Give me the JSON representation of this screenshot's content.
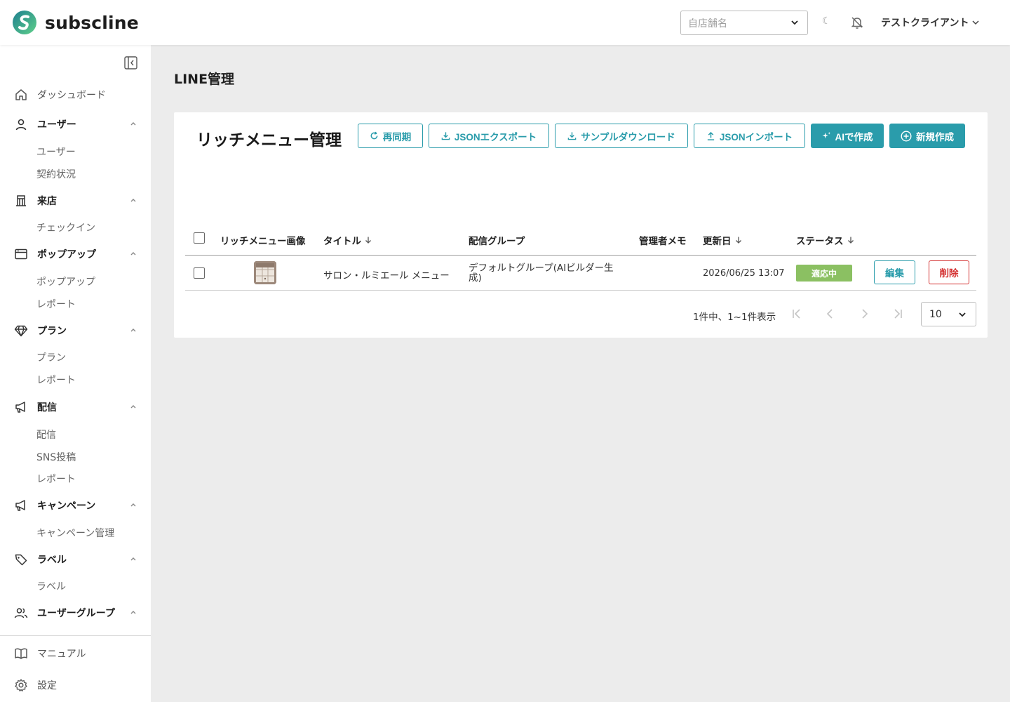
{
  "brand": {
    "name": "subscline"
  },
  "header": {
    "store_placeholder": "自店舗名",
    "theme_icon": "☾",
    "user_name": "テストクライアント"
  },
  "sidebar": {
    "dashboard": "ダッシュボード",
    "sections": [
      {
        "label": "ユーザー",
        "icon": "user-icon",
        "items": [
          "ユーザー",
          "契約状況"
        ]
      },
      {
        "label": "来店",
        "icon": "building-icon",
        "items": [
          "チェックイン"
        ]
      },
      {
        "label": "ポップアップ",
        "icon": "window-icon",
        "items": [
          "ポップアップ",
          "レポート"
        ]
      },
      {
        "label": "プラン",
        "icon": "diamond-icon",
        "items": [
          "プラン",
          "レポート"
        ]
      },
      {
        "label": "配信",
        "icon": "megaphone-icon",
        "items": [
          "配信",
          "SNS投稿",
          "レポート"
        ]
      },
      {
        "label": "キャンペーン",
        "icon": "megaphone-icon",
        "items": [
          "キャンペーン管理"
        ]
      },
      {
        "label": "ラベル",
        "icon": "tag-icon",
        "items": [
          "ラベル"
        ]
      },
      {
        "label": "ユーザーグループ",
        "icon": "users-icon",
        "items": []
      }
    ],
    "manual": "マニュアル",
    "settings": "設定"
  },
  "main": {
    "page_title": "LINE管理",
    "card_title": "リッチメニュー管理",
    "buttons": {
      "resync": "再同期",
      "json_export": "JSONエクスポート",
      "sample_download": "サンプルダウンロード",
      "json_import": "JSONインポート",
      "ai_create": "AIで作成",
      "new_create": "新規作成"
    },
    "table": {
      "columns": [
        "リッチメニュー画像",
        "タイトル",
        "配信グループ",
        "管理者メモ",
        "更新日",
        "ステータス"
      ],
      "rows": [
        {
          "title": "サロン・ルミエール メニュー",
          "group_line1": "デフォルトグループ(AIビルダー生",
          "group_line2": "成)",
          "memo": "",
          "updated": "2026/06/25 13:07",
          "status": "適応中",
          "edit": "編集",
          "delete": "削除"
        }
      ]
    },
    "pagination": {
      "info": "1件中、1~1件表示",
      "page_size": "10"
    }
  },
  "colors": {
    "accent": "#2a9cab",
    "status_active": "#8bc062",
    "danger": "#d32f2f",
    "background": "#ececec"
  }
}
